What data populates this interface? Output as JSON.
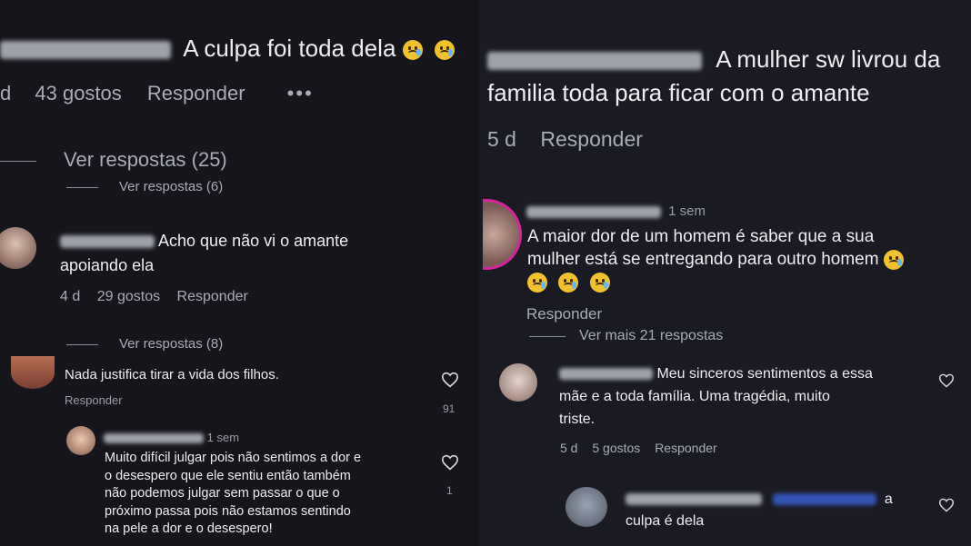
{
  "left": {
    "top_comment": {
      "text": "A culpa foi toda dela",
      "age_partial": "d",
      "likes": "43 gostos",
      "reply": "Responder",
      "more": "•••",
      "view_replies": "Ver respostas (25)"
    },
    "sub_view_replies": "Ver respostas (6)",
    "comment2": {
      "text_line1": "Acho que não vi o amante",
      "text_line2": "apoiando ela",
      "age": "4 d",
      "likes": "29 gostos",
      "reply": "Responder",
      "view_replies": "Ver respostas (8)"
    },
    "comment3": {
      "text": "Nada justifica tirar a vida dos filhos.",
      "reply": "Responder",
      "like_count": "91"
    },
    "comment4": {
      "age": "1 sem",
      "lines": [
        "Muito difícil julgar pois não sentimos a dor e",
        "o desespero que ele sentiu então também",
        "não podemos julgar sem passar o que o",
        "próximo passa pois não estamos  sentindo",
        "na pele a dor e o desespero!"
      ],
      "like_count": "1"
    }
  },
  "right": {
    "top_comment": {
      "text_line1": "A mulher sw livrou da",
      "text_line2": "familia toda para ficar com o amante",
      "age": "5 d",
      "reply": "Responder"
    },
    "comment2": {
      "age": "1 sem",
      "text_line1": "A maior dor de um homem é saber que a sua",
      "text_line2": "mulher está se entregando para outro homem",
      "reply": "Responder",
      "view_more": "Ver mais 21 respostas"
    },
    "comment3": {
      "text_line1": "Meu sinceros sentimentos a essa",
      "text_line2": "mãe e a toda família. Uma tragédia, muito",
      "text_line3": "triste.",
      "age": "5 d",
      "likes": "5 gostos",
      "reply": "Responder"
    },
    "comment4": {
      "text_suffix": "a",
      "text_line2": "culpa é dela"
    }
  },
  "colors": {
    "background_left": "#15151b",
    "background_right": "#1a1a22",
    "text": "#eceef2",
    "meta": "#a9acb5",
    "mention_blue": "#3a5fd0",
    "story_ring": "#d6249f"
  },
  "icons": [
    "heart-icon",
    "crying-face-emoji",
    "more-options-icon",
    "avatar"
  ]
}
